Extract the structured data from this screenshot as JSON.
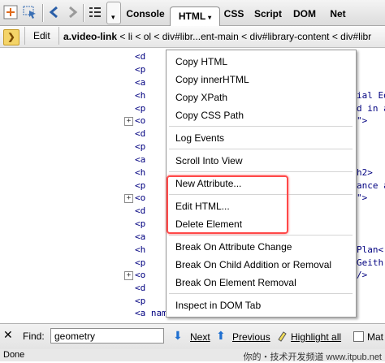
{
  "toolbar": {
    "tabs": [
      {
        "label": "Console"
      },
      {
        "label": "HTML",
        "dropdown": "▾",
        "active": true
      },
      {
        "label": "CSS"
      },
      {
        "label": "Script"
      },
      {
        "label": "DOM"
      },
      {
        "label": "Net"
      }
    ],
    "mini_button_glyph": "▾",
    "icons": [
      "firebug-icon",
      "inspect-icon",
      "back-icon",
      "forward-icon",
      "list-icon"
    ]
  },
  "breadcrumb_bar": {
    "edit_label": "Edit",
    "first_crumb": "a.video-link",
    "rest": " < li < ol < div#libr...ent-main < div#library-content < div#libr"
  },
  "code_lines": [
    {
      "text": "<d"
    },
    {
      "text": "<p"
    },
    {
      "text": "<a"
    },
    {
      "text": "<h"
    },
    {
      "text": "<p"
    },
    {
      "text": "<o"
    },
    {
      "text": "<d"
    },
    {
      "text": "<p"
    },
    {
      "text": "<a"
    },
    {
      "text": "<h"
    },
    {
      "text": "<p"
    },
    {
      "text": "<o"
    },
    {
      "text": "<d"
    },
    {
      "text": "<p"
    },
    {
      "text": "<a"
    },
    {
      "text": "<h"
    },
    {
      "text": "<p"
    },
    {
      "text": "<o"
    },
    {
      "text": "<d"
    },
    {
      "text": "<p"
    },
    {
      "text": "<a name=\"Geometry\"></a>"
    }
  ],
  "code_right": [
    {
      "text": "ial Ed"
    },
    {
      "text": "d in a"
    },
    {
      "text": "\">"
    },
    {
      "text": "h2>"
    },
    {
      "text": "ance a"
    },
    {
      "text": "\">"
    },
    {
      "text": "Plan<"
    },
    {
      "text": "Geith"
    },
    {
      "text": "/>"
    }
  ],
  "context_menu": {
    "items": [
      {
        "label": "Copy HTML"
      },
      {
        "label": "Copy innerHTML"
      },
      {
        "label": "Copy XPath"
      },
      {
        "label": "Copy CSS Path"
      },
      {
        "label": "Log Events"
      },
      {
        "label": "Scroll Into View"
      },
      {
        "label": "New Attribute..."
      },
      {
        "label": "Edit HTML..."
      },
      {
        "label": "Delete Element"
      },
      {
        "label": "Break On Attribute Change"
      },
      {
        "label": "Break On Child Addition or Removal"
      },
      {
        "label": "Break On Element Removal"
      },
      {
        "label": "Inspect in DOM Tab"
      }
    ],
    "highlight_color": "#ff4848"
  },
  "find_bar": {
    "close_glyph": "✕",
    "label": "Find:",
    "value": "geometry",
    "next_label": "Next",
    "previous_label": "Previous",
    "highlight_all_label": "Highlight all",
    "match_case_label": "Mat"
  },
  "status_bar": {
    "text": "Done",
    "watermark": "你的・技术开发频道 www.itpub.net"
  }
}
